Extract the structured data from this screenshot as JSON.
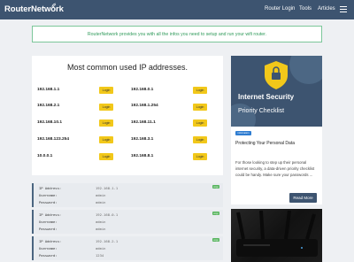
{
  "header": {
    "logo": "RouterNetwork",
    "nav": {
      "router_login": "Router Login",
      "tools": "Tools",
      "articles": "Articles"
    }
  },
  "banner": {
    "text": "RouterNetwork provides you with all the infos you need to setup and run your wifi router."
  },
  "main": {
    "title": "Most common used IP addresses.",
    "login_label": "Login",
    "ips": [
      [
        "192.168.1.1",
        "192.168.0.1"
      ],
      [
        "192.168.2.1",
        "192.168.1.254"
      ],
      [
        "192.168.10.1",
        "192.168.11.1"
      ],
      [
        "192.168.123.254",
        "192.168.3.1"
      ],
      [
        "10.0.0.1",
        "192.168.8.1"
      ]
    ]
  },
  "credentials": [
    {
      "ip_key": "IP Address:",
      "ip": "192.168.1.1",
      "user_key": "Username:",
      "user": "admin",
      "pass_key": "Password:",
      "pass": "admin",
      "badge": "copy"
    },
    {
      "ip_key": "IP Address:",
      "ip": "192.168.0.1",
      "user_key": "Username:",
      "user": "admin",
      "pass_key": "Password:",
      "pass": "admin",
      "badge": "copy"
    },
    {
      "ip_key": "IP Address:",
      "ip": "192.168.2.1",
      "user_key": "Username:",
      "user": "admin",
      "pass_key": "Password:",
      "pass": "1234",
      "badge": "copy"
    }
  ],
  "sidebar": {
    "image_title": "Internet Security",
    "image_subtitle": "Priority Checklist",
    "tag": "information",
    "heading": "Protecting Your Personal Data",
    "description": "For those looking to step up their personal internet security, a data-driven priority checklist could be handy. Make sure your passwords ...",
    "read_more": "Read More"
  },
  "colors": {
    "header": "#3d5470",
    "accent_green": "#2f9a5a",
    "login_yellow": "#f2c81a"
  }
}
